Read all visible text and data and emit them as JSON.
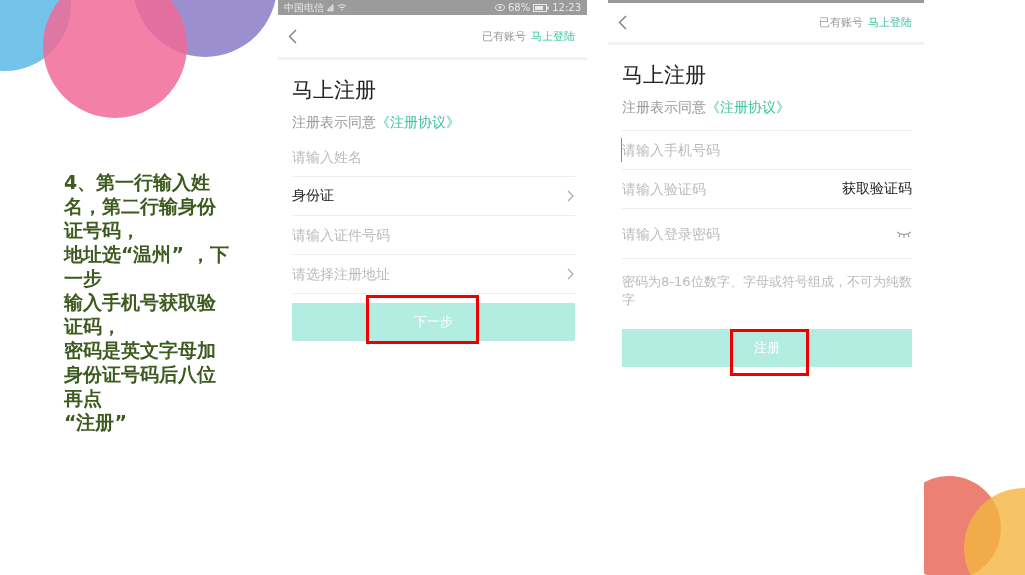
{
  "slide": {
    "instructions": [
      "4、第一行输入姓名，第二行输身份证号码，",
      "地址选“温州” ，下一步",
      "输入手机号获取验证码，",
      "密码是英文字母加身份证号码后八位再点",
      "“注册”"
    ]
  },
  "phones": [
    {
      "status_bar": {
        "carrier": "中国电信",
        "battery": "68%",
        "time": "12:23"
      },
      "header": {
        "prompt": "已有账号",
        "link": "马上登陆"
      },
      "title": "马上注册",
      "agreement": {
        "prefix": "注册表示同意",
        "link": "《注册协议》"
      },
      "fields": [
        {
          "kind": "input",
          "placeholder": "请输入姓名",
          "focused": false
        },
        {
          "kind": "select",
          "value": "身份证",
          "focused": false
        },
        {
          "kind": "input",
          "placeholder": "请输入证件号码",
          "focused": false
        },
        {
          "kind": "select",
          "placeholder": "请选择注册地址",
          "focused": false
        }
      ],
      "button": {
        "label": "下一步",
        "highlighted": true
      }
    },
    {
      "header": {
        "prompt": "已有账号",
        "link": "马上登陆"
      },
      "title": "马上注册",
      "agreement": {
        "prefix": "注册表示同意",
        "link": "《注册协议》"
      },
      "fields": [
        {
          "kind": "input",
          "placeholder": "请输入手机号码",
          "focused": true
        },
        {
          "kind": "code",
          "placeholder": "请输入验证码",
          "action": "获取验证码",
          "focused": false
        },
        {
          "kind": "password",
          "placeholder": "请输入登录密码",
          "focused": false
        }
      ],
      "hint": "密码为8-16位数字、字母或符号组成，不可为纯数字",
      "button": {
        "label": "注册",
        "highlighted": true
      }
    }
  ]
}
